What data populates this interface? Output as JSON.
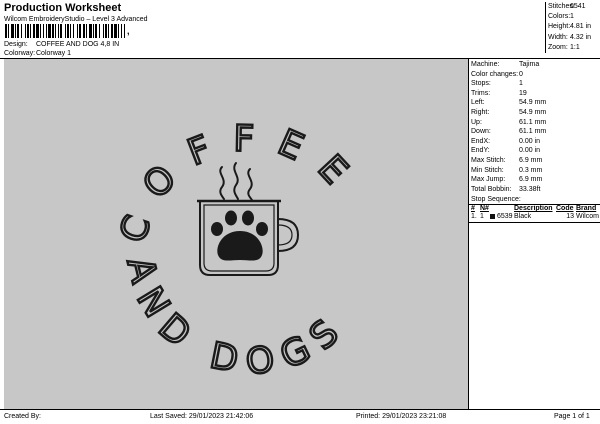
{
  "header": {
    "title": "Production Worksheet",
    "subtitle": "Wilcom EmbroideryStudio – Level 3 Advanced",
    "barcode_mark": ",",
    "design_label": "Design:",
    "design_value": "COFFEE AND DOG 4,8 IN",
    "colorway_label": "Colorway:",
    "colorway_value": "Colorway 1"
  },
  "stats": [
    {
      "label": "Stitches:",
      "value": "6541"
    },
    {
      "label": "Colors:",
      "value": "1"
    },
    {
      "label": "Height:",
      "value": "4.81 in"
    },
    {
      "label": "Width:",
      "value": "4.32 in"
    },
    {
      "label": "Zoom:",
      "value": "1:1"
    }
  ],
  "machine_info": [
    {
      "label": "Machine:",
      "value": "Tajima"
    },
    {
      "label": "Color changes:",
      "value": "0"
    },
    {
      "label": "Stops:",
      "value": "1"
    },
    {
      "label": "Trims:",
      "value": "19"
    },
    {
      "label": "Left:",
      "value": "54.9 mm"
    },
    {
      "label": "Right:",
      "value": "54.9 mm"
    },
    {
      "label": "Up:",
      "value": "61.1 mm"
    },
    {
      "label": "Down:",
      "value": "61.1 mm"
    },
    {
      "label": "EndX:",
      "value": "0.00 in"
    },
    {
      "label": "EndY:",
      "value": "0.00 in"
    },
    {
      "label": "Max Stitch:",
      "value": "6.9 mm"
    },
    {
      "label": "Min Stitch:",
      "value": "0.3 mm"
    },
    {
      "label": "Max Jump:",
      "value": "6.9 mm"
    },
    {
      "label": "Total Bobbin:",
      "value": "33.38ft"
    }
  ],
  "stop_sequence": {
    "title": "Stop Sequence:",
    "headers": [
      "#",
      "N#",
      "",
      "Description",
      "Code",
      "Brand"
    ],
    "rows": [
      {
        "num": "1.",
        "n": "1",
        "stitches": "6539",
        "description": "Black",
        "code": "13",
        "brand": "Wilcom",
        "color": "#111111"
      }
    ]
  },
  "design": {
    "arc_top": "COFFEE",
    "arc_bottom": "AND DOGS",
    "background": "#c7c7c7",
    "thread_color": "#1a1a1a"
  },
  "footer": {
    "created_by": "Created By:",
    "last_saved": "Last Saved: 29/01/2023 21:42:06",
    "printed": "Printed: 29/01/2023 23:21:08",
    "page": "Page 1 of 1"
  }
}
